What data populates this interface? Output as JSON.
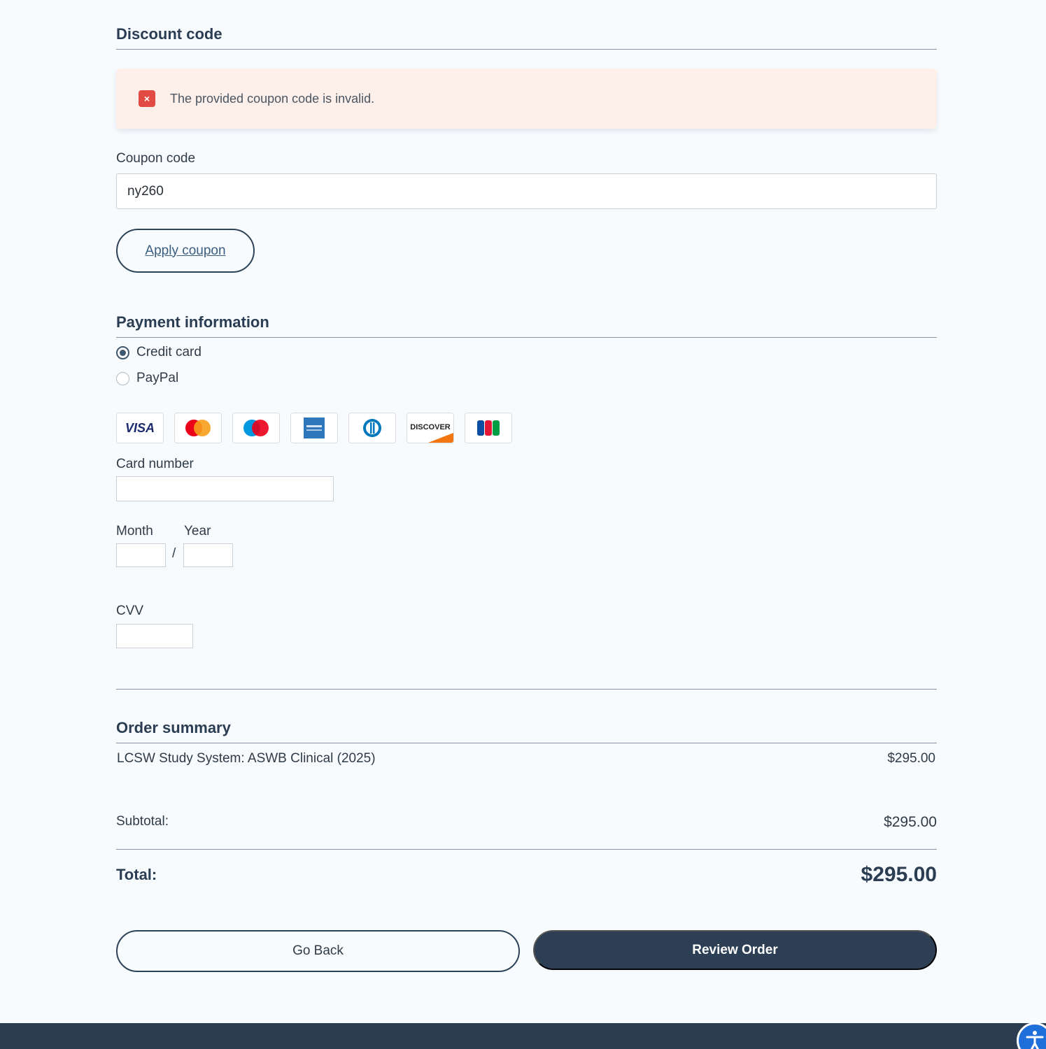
{
  "discount": {
    "title": "Discount code",
    "alert_icon": "×",
    "alert_text": "The provided coupon code is invalid.",
    "coupon_label": "Coupon code",
    "coupon_value": "ny260",
    "apply_label": "Apply coupon"
  },
  "payment": {
    "title": "Payment information",
    "methods": [
      {
        "label": "Credit card",
        "selected": true
      },
      {
        "label": "PayPal",
        "selected": false
      }
    ],
    "card_brands": [
      "VISA",
      "Mastercard",
      "Maestro",
      "American Express",
      "Diners Club",
      "DISCOVER",
      "JCB"
    ],
    "card_number_label": "Card number",
    "month_label": "Month",
    "year_label": "Year",
    "date_separator": "/",
    "cvv_label": "CVV"
  },
  "summary": {
    "title": "Order summary",
    "item_name": "LCSW Study System: ASWB Clinical (2025)",
    "item_price": "$295.00",
    "subtotal_label": "Subtotal:",
    "subtotal_value": "$295.00",
    "total_label": "Total:",
    "total_value": "$295.00"
  },
  "actions": {
    "back_label": "Go Back",
    "review_label": "Review Order"
  }
}
